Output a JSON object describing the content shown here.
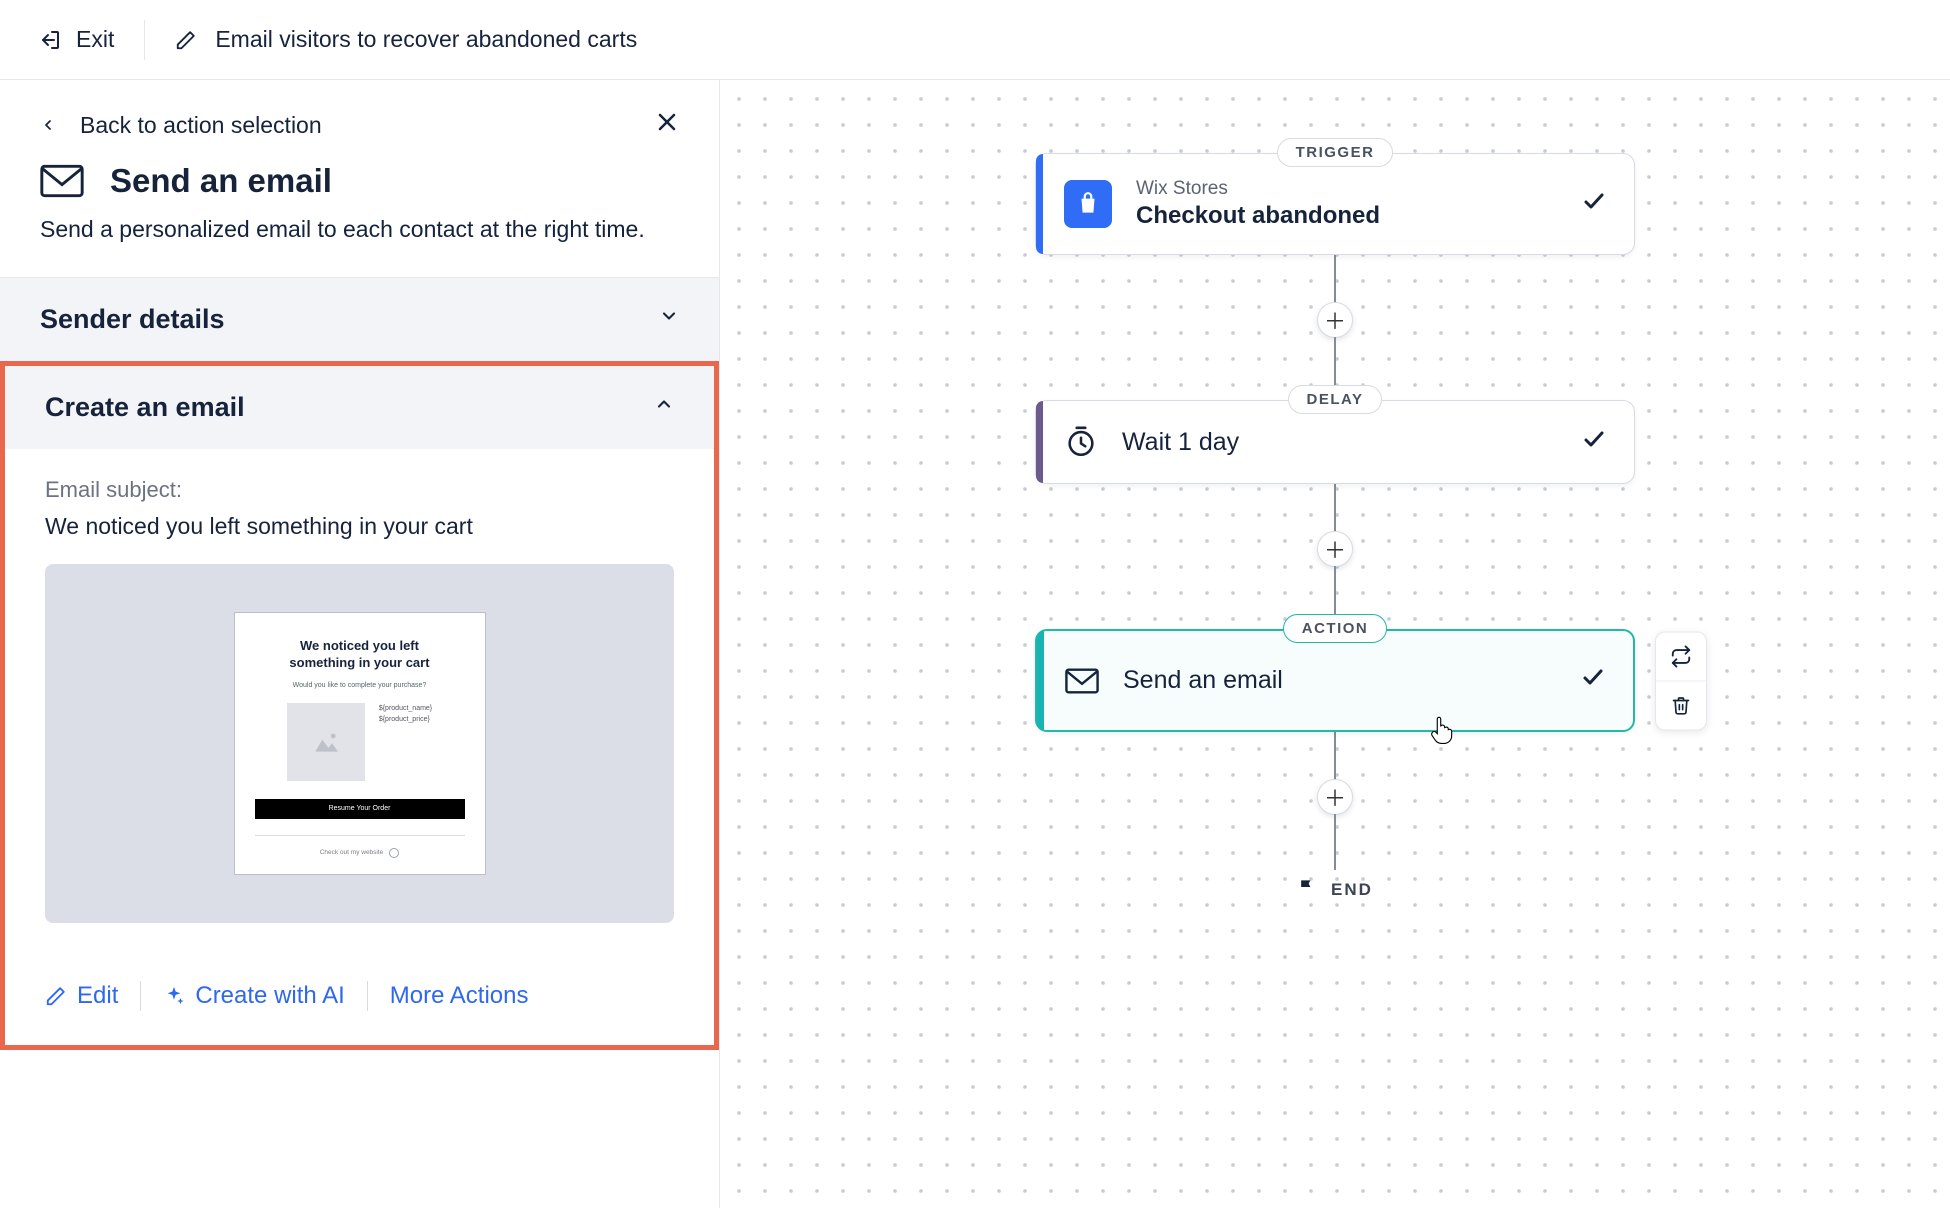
{
  "topbar": {
    "exit": "Exit",
    "title": "Email visitors to recover abandoned carts"
  },
  "sidebar": {
    "back_label": "Back to action selection",
    "title": "Send an email",
    "description": "Send a personalized email to each contact at the right time.",
    "sections": {
      "sender": {
        "title": "Sender details"
      },
      "create": {
        "title": "Create an email",
        "subject_label": "Email subject:",
        "subject_value": "We noticed you left something in your cart",
        "preview": {
          "heading_line1": "We noticed you left",
          "heading_line2": "something in your cart",
          "subtext": "Would you like to complete your purchase?",
          "meta1": "${product_name}",
          "meta2": "${product_price}",
          "cta": "Resume Your Order",
          "footer": "Check out my website"
        }
      }
    },
    "actions": {
      "edit": "Edit",
      "create_ai": "Create with AI",
      "more": "More Actions"
    }
  },
  "flow": {
    "badges": {
      "trigger": "TRIGGER",
      "delay": "DELAY",
      "action": "ACTION"
    },
    "trigger": {
      "sup": "Wix Stores",
      "title": "Checkout abandoned",
      "accent": "#2f6df6"
    },
    "delay": {
      "title": "Wait 1 day",
      "accent": "#6a5a8e"
    },
    "action": {
      "title": "Send an email",
      "accent": "#19b3b3"
    },
    "end": "END"
  }
}
